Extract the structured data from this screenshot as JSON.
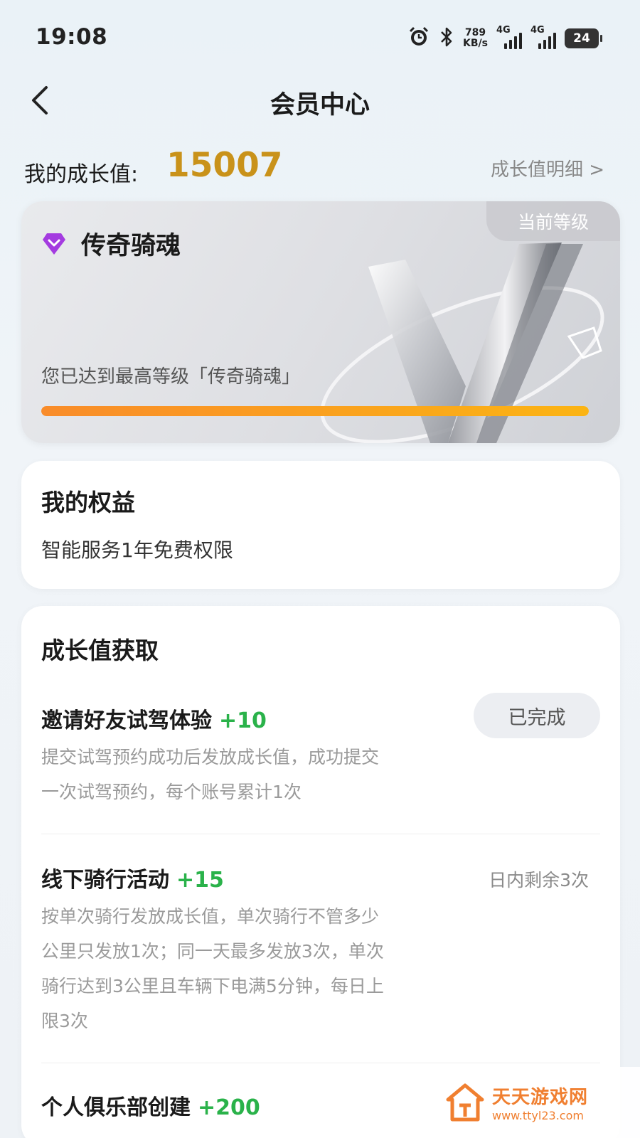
{
  "status_bar": {
    "time": "19:08",
    "speed_value": "789",
    "speed_unit": "KB/s",
    "sim1_label": "4G",
    "sim2_label": "4G",
    "battery": "24"
  },
  "nav": {
    "title": "会员中心"
  },
  "growth": {
    "label": "我的成长值:",
    "value": "15007",
    "detail_link": "成长值明细 >"
  },
  "level_card": {
    "badge": "当前等级",
    "name": "传奇骑魂",
    "description": "您已达到最高等级「传奇骑魂」",
    "progress_fraction": 1.0
  },
  "benefits": {
    "title": "我的权益",
    "items": [
      "智能服务1年免费权限"
    ]
  },
  "earn": {
    "title": "成长值获取",
    "tasks": [
      {
        "title": "邀请好友试驾体验",
        "points": "+10",
        "desc_lines": [
          "提交试驾预约成功后发放成长值，成功提交",
          "一次试驾预约，每个账号累计1次"
        ],
        "action": "已完成"
      },
      {
        "title": "线下骑行活动",
        "points": "+15",
        "desc_lines": [
          "按单次骑行发放成长值，单次骑行不管多少",
          "公里只发放1次；同一天最多发放3次，单次",
          "骑行达到3公里且车辆下电满5分钟，每日上",
          "限3次"
        ],
        "remaining": "日内剩余3次"
      },
      {
        "title": "个人俱乐部创建",
        "points": "+200"
      }
    ]
  },
  "watermark": {
    "name": "天天游戏网",
    "url": "www.ttyl23.com"
  },
  "colors": {
    "accent_gold": "#c9921a",
    "points_green": "#2ab24a",
    "progress_start": "#f98c2a",
    "progress_end": "#fbb414",
    "diamond_purple": "#a43be0"
  }
}
